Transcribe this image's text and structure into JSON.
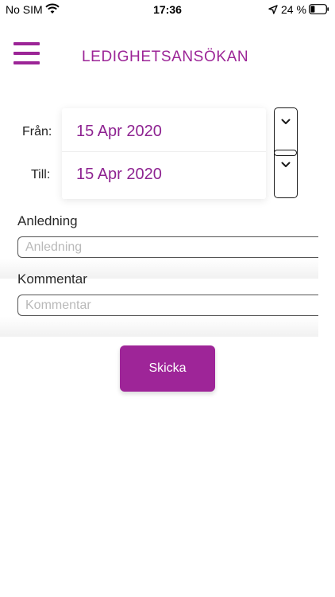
{
  "status_bar": {
    "carrier": "No SIM",
    "time": "17:36",
    "battery": "24 %"
  },
  "header": {
    "title": "LEDIGHETSANSÖKAN",
    "menu_icon": "hamburger-menu-icon"
  },
  "dates": {
    "from_label": "Från:",
    "from_value": "15 Apr 2020",
    "to_label": "Till:",
    "to_value": "15 Apr 2020"
  },
  "reason": {
    "label": "Anledning",
    "placeholder": "Anledning",
    "value": ""
  },
  "comment": {
    "label": "Kommentar",
    "placeholder": "Kommentar",
    "value": ""
  },
  "submit": {
    "label": "Skicka"
  },
  "colors": {
    "accent": "#9c2597",
    "date_text": "#8e2391",
    "button": "#9e2598"
  }
}
